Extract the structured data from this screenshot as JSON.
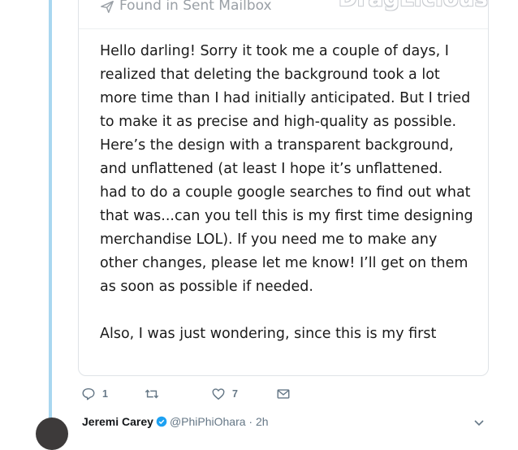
{
  "mail_header": {
    "label": "Found in Sent Mailbox",
    "brand_logo": "DragLicious"
  },
  "email_body": {
    "paragraphs": [
      "Hello darling! Sorry it took me a couple of days, I realized that deleting the background took a lot more time than I had initially anticipated.  But I tried to make it as precise and high-quality as possible.  Here’s the design with a transparent background, and unflattened (at least I hope it’s unflattened. had to do a couple google searches to find out what that was...can you tell this is my first time designing merchandise LOL). If you need me to make any other changes, please let me know! I’ll get on them as soon as possible if needed.",
      "Also, I was just wondering, since this is my first"
    ]
  },
  "actions": {
    "reply_count": "1",
    "retweet_count": "",
    "like_count": "7"
  },
  "next_tweet": {
    "author_name": "Jeremi Carey",
    "handle_time": "@PhiPhiOhara · 2h"
  },
  "colors": {
    "thread_line": "#a9d7f0",
    "icon_gray": "#657786",
    "verified_blue": "#1da1f2"
  }
}
